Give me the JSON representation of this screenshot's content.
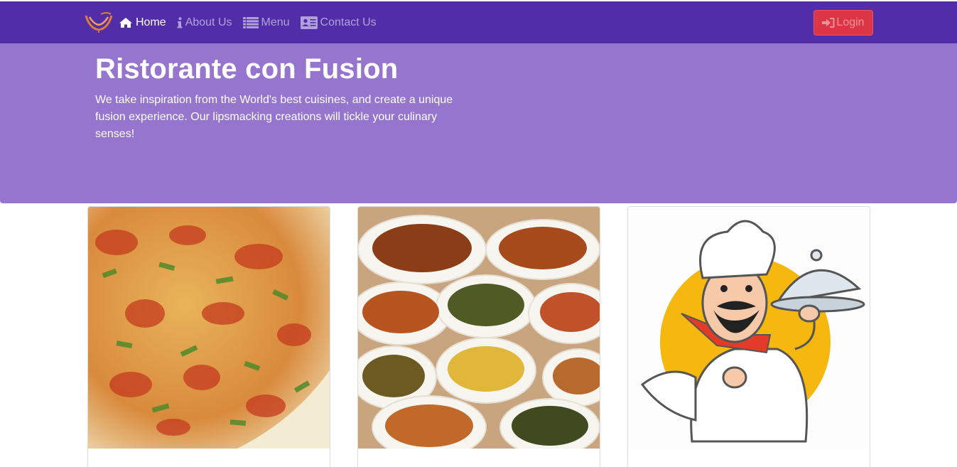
{
  "navbar": {
    "brand_icon": "ristorante-logo",
    "items": [
      {
        "label": "Home",
        "icon": "home-icon",
        "active": true
      },
      {
        "label": "About Us",
        "icon": "info-icon",
        "active": false
      },
      {
        "label": "Menu",
        "icon": "list-icon",
        "active": false
      },
      {
        "label": "Contact Us",
        "icon": "address-card-icon",
        "active": false
      }
    ],
    "login": {
      "label": "Login",
      "icon": "sign-in-icon"
    }
  },
  "jumbotron": {
    "title": "Ristorante con Fusion",
    "text": "We take inspiration from the World's best cuisines, and create a unique fusion experience. Our lipsmacking creations will tickle your culinary senses!"
  },
  "colors": {
    "navbar": "#512da8",
    "jumbotron": "#9575cd",
    "login_button": "#dc3545"
  }
}
